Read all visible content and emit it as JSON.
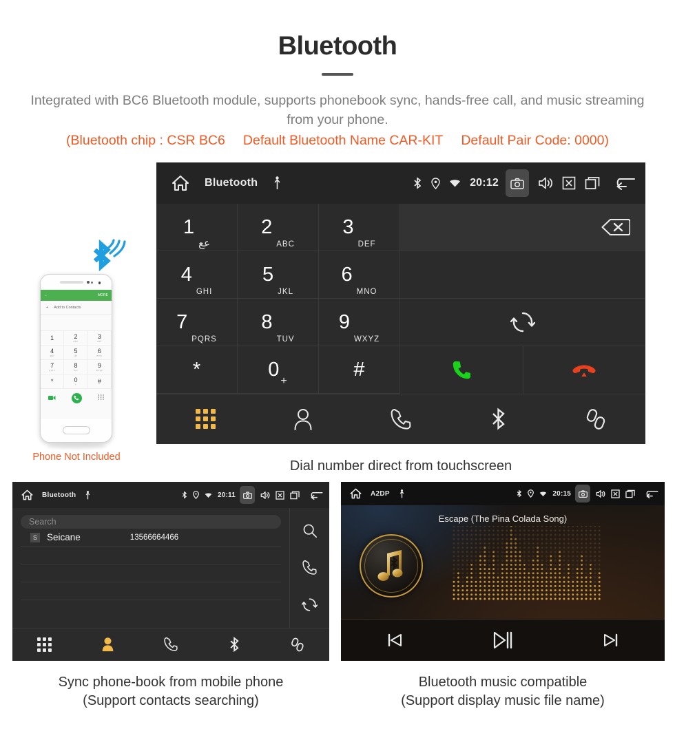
{
  "header": {
    "title": "Bluetooth",
    "subtitle": "Integrated with BC6 Bluetooth module, supports phonebook sync, hands-free call, and music streaming from your phone.",
    "spec_chip": "(Bluetooth chip : CSR BC6",
    "spec_name": "Default Bluetooth Name CAR-KIT",
    "spec_pair": "Default Pair Code: 0000)",
    "accent_color": "#f15a24",
    "subtitle_color": "#7d7d7d"
  },
  "dialer": {
    "statusbar": {
      "title": "Bluetooth",
      "time": "20:12",
      "icons": [
        "home-icon",
        "usb-icon",
        "bluetooth-icon",
        "location-icon",
        "wifi-icon",
        "camera-icon",
        "volume-icon",
        "close-box-icon",
        "recent-apps-icon",
        "back-icon"
      ]
    },
    "keys": [
      {
        "num": "1",
        "sub": "عع"
      },
      {
        "num": "2",
        "sub": "ABC"
      },
      {
        "num": "3",
        "sub": "DEF"
      },
      {
        "num": "4",
        "sub": "GHI"
      },
      {
        "num": "5",
        "sub": "JKL"
      },
      {
        "num": "6",
        "sub": "MNO"
      },
      {
        "num": "7",
        "sub": "PQRS"
      },
      {
        "num": "8",
        "sub": "TUV"
      },
      {
        "num": "9",
        "sub": "WXYZ"
      },
      {
        "num": "*",
        "sub": ""
      },
      {
        "num": "0",
        "sub": "+"
      },
      {
        "num": "#",
        "sub": ""
      }
    ],
    "number_input_value": "",
    "actions": {
      "backspace": "backspace-icon",
      "sync": "sync-icon",
      "call": "call-icon",
      "hangup": "hangup-icon"
    },
    "nav": [
      {
        "name": "keypad",
        "active": true
      },
      {
        "name": "contacts",
        "active": false
      },
      {
        "name": "call-history",
        "active": false
      },
      {
        "name": "bluetooth",
        "active": false
      },
      {
        "name": "link",
        "active": false
      }
    ],
    "active_color": "#f3b84a",
    "caption": "Dial number direct from touchscreen"
  },
  "phone_mock": {
    "header_back": "←",
    "header_more": "MORE",
    "add_row": "Add to Contacts",
    "keys": [
      {
        "num": "1",
        "sub": ""
      },
      {
        "num": "2",
        "sub": "abc"
      },
      {
        "num": "3",
        "sub": "def"
      },
      {
        "num": "4",
        "sub": "ghi"
      },
      {
        "num": "5",
        "sub": "jkl"
      },
      {
        "num": "6",
        "sub": "mno"
      },
      {
        "num": "7",
        "sub": "pqrs"
      },
      {
        "num": "8",
        "sub": "tuv"
      },
      {
        "num": "9",
        "sub": "wxyz"
      },
      {
        "num": "*",
        "sub": ""
      },
      {
        "num": "0",
        "sub": "+"
      },
      {
        "num": "#",
        "sub": ""
      }
    ],
    "not_included_label": "Phone Not Included",
    "not_included_color": "#f15a24",
    "bluetooth_logo_color": "#1f9ee0"
  },
  "phonebook": {
    "statusbar": {
      "title": "Bluetooth",
      "time": "20:11"
    },
    "search_placeholder": "Search",
    "search_value": "",
    "contacts": [
      {
        "badge": "S",
        "name": "Seicane",
        "number": "13566664466"
      }
    ],
    "empty_rows": 4,
    "side_actions": [
      "search-icon",
      "call-icon",
      "sync-icon"
    ],
    "nav": [
      {
        "name": "keypad",
        "active": false
      },
      {
        "name": "contacts",
        "active": true
      },
      {
        "name": "call-history",
        "active": false
      },
      {
        "name": "bluetooth",
        "active": false
      },
      {
        "name": "link",
        "active": false
      }
    ],
    "active_color": "#f3b84a",
    "caption_line1": "Sync phone-book from mobile phone",
    "caption_line2": "(Support contacts searching)"
  },
  "music": {
    "statusbar": {
      "title": "A2DP",
      "time": "20:15"
    },
    "song_title": "Escape (The Pina Colada Song)",
    "controls": [
      "previous-track-icon",
      "play-pause-icon",
      "next-track-icon"
    ],
    "accent_gold": "#c79a3c",
    "caption_line1": "Bluetooth music compatible",
    "caption_line2": "(Support display music file name)"
  }
}
